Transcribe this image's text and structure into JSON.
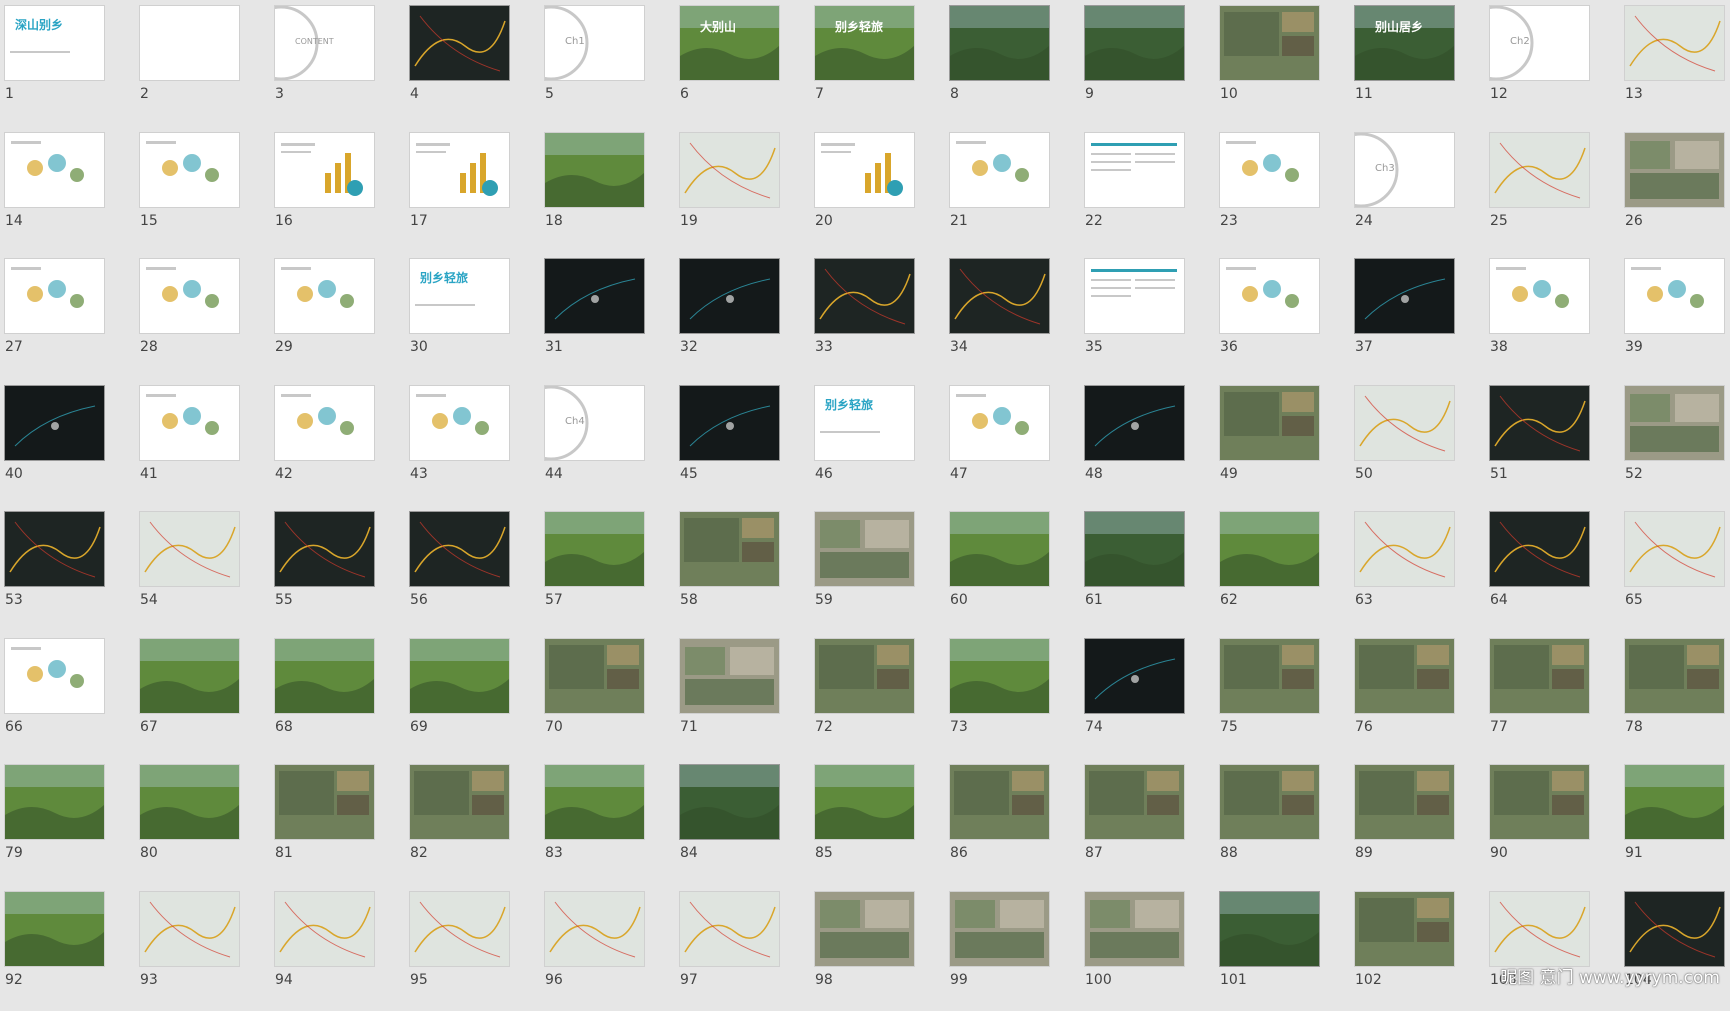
{
  "watermark": "昵图 意门 www.yyrym.com",
  "palette": {
    "white": "#ffffff",
    "dark": "#1e2523",
    "forest": "#3b5e34",
    "photo": "#6f7f5a",
    "greenField": "#5f8a3c",
    "sky": "#b9d3e6",
    "map": "#dfe4df",
    "night": "#14191a",
    "mixed": "#9b9a86",
    "accent": "#d9a62b",
    "red": "#d33a2c",
    "teal": "#2f9fb3",
    "gray": "#c8c8c8"
  },
  "slides": [
    {
      "num": "1",
      "kind": "title",
      "title": "深山别乡"
    },
    {
      "num": "2",
      "kind": "white"
    },
    {
      "num": "3",
      "kind": "chapter",
      "title": "CONTENT"
    },
    {
      "num": "4",
      "kind": "dark-map"
    },
    {
      "num": "5",
      "kind": "chapter",
      "title": "Ch1"
    },
    {
      "num": "6",
      "kind": "photo-green",
      "title": "大别山"
    },
    {
      "num": "7",
      "kind": "photo-green",
      "title": "别乡轻旅"
    },
    {
      "num": "8",
      "kind": "forest"
    },
    {
      "num": "9",
      "kind": "forest"
    },
    {
      "num": "10",
      "kind": "photo"
    },
    {
      "num": "11",
      "kind": "forest",
      "title": "别山居乡"
    },
    {
      "num": "12",
      "kind": "chapter",
      "title": "Ch2"
    },
    {
      "num": "13",
      "kind": "map"
    },
    {
      "num": "14",
      "kind": "diagram"
    },
    {
      "num": "15",
      "kind": "diagram"
    },
    {
      "num": "16",
      "kind": "chart"
    },
    {
      "num": "17",
      "kind": "chart"
    },
    {
      "num": "18",
      "kind": "photo-green"
    },
    {
      "num": "19",
      "kind": "map"
    },
    {
      "num": "20",
      "kind": "chart"
    },
    {
      "num": "21",
      "kind": "diagram"
    },
    {
      "num": "22",
      "kind": "text"
    },
    {
      "num": "23",
      "kind": "diagram"
    },
    {
      "num": "24",
      "kind": "chapter",
      "title": "Ch3"
    },
    {
      "num": "25",
      "kind": "map"
    },
    {
      "num": "26",
      "kind": "mixed"
    },
    {
      "num": "27",
      "kind": "diagram"
    },
    {
      "num": "28",
      "kind": "diagram"
    },
    {
      "num": "29",
      "kind": "diagram"
    },
    {
      "num": "30",
      "kind": "title",
      "title": "别乡轻旅"
    },
    {
      "num": "31",
      "kind": "dark"
    },
    {
      "num": "32",
      "kind": "dark"
    },
    {
      "num": "33",
      "kind": "dark-map"
    },
    {
      "num": "34",
      "kind": "dark-map"
    },
    {
      "num": "35",
      "kind": "text"
    },
    {
      "num": "36",
      "kind": "diagram"
    },
    {
      "num": "37",
      "kind": "dark"
    },
    {
      "num": "38",
      "kind": "diagram"
    },
    {
      "num": "39",
      "kind": "diagram"
    },
    {
      "num": "40",
      "kind": "dark"
    },
    {
      "num": "41",
      "kind": "diagram"
    },
    {
      "num": "42",
      "kind": "diagram"
    },
    {
      "num": "43",
      "kind": "diagram"
    },
    {
      "num": "44",
      "kind": "chapter",
      "title": "Ch4"
    },
    {
      "num": "45",
      "kind": "dark"
    },
    {
      "num": "46",
      "kind": "title",
      "title": "别乡轻旅"
    },
    {
      "num": "47",
      "kind": "diagram"
    },
    {
      "num": "48",
      "kind": "dark"
    },
    {
      "num": "49",
      "kind": "photo"
    },
    {
      "num": "50",
      "kind": "map"
    },
    {
      "num": "51",
      "kind": "dark-map"
    },
    {
      "num": "52",
      "kind": "mixed"
    },
    {
      "num": "53",
      "kind": "dark-map"
    },
    {
      "num": "54",
      "kind": "map"
    },
    {
      "num": "55",
      "kind": "dark-map"
    },
    {
      "num": "56",
      "kind": "dark-map"
    },
    {
      "num": "57",
      "kind": "photo-green"
    },
    {
      "num": "58",
      "kind": "photo"
    },
    {
      "num": "59",
      "kind": "mixed"
    },
    {
      "num": "60",
      "kind": "photo-green"
    },
    {
      "num": "61",
      "kind": "forest"
    },
    {
      "num": "62",
      "kind": "photo-green"
    },
    {
      "num": "63",
      "kind": "map"
    },
    {
      "num": "64",
      "kind": "dark-map"
    },
    {
      "num": "65",
      "kind": "map"
    },
    {
      "num": "66",
      "kind": "diagram"
    },
    {
      "num": "67",
      "kind": "photo-green"
    },
    {
      "num": "68",
      "kind": "photo-green"
    },
    {
      "num": "69",
      "kind": "photo-green"
    },
    {
      "num": "70",
      "kind": "photo"
    },
    {
      "num": "71",
      "kind": "mixed"
    },
    {
      "num": "72",
      "kind": "photo"
    },
    {
      "num": "73",
      "kind": "photo-green"
    },
    {
      "num": "74",
      "kind": "dark"
    },
    {
      "num": "75",
      "kind": "photo"
    },
    {
      "num": "76",
      "kind": "photo"
    },
    {
      "num": "77",
      "kind": "photo"
    },
    {
      "num": "78",
      "kind": "photo"
    },
    {
      "num": "79",
      "kind": "photo-green"
    },
    {
      "num": "80",
      "kind": "photo-green"
    },
    {
      "num": "81",
      "kind": "photo"
    },
    {
      "num": "82",
      "kind": "photo"
    },
    {
      "num": "83",
      "kind": "photo-green"
    },
    {
      "num": "84",
      "kind": "forest"
    },
    {
      "num": "85",
      "kind": "photo-green"
    },
    {
      "num": "86",
      "kind": "photo"
    },
    {
      "num": "87",
      "kind": "photo"
    },
    {
      "num": "88",
      "kind": "photo"
    },
    {
      "num": "89",
      "kind": "photo"
    },
    {
      "num": "90",
      "kind": "photo"
    },
    {
      "num": "91",
      "kind": "photo-green"
    },
    {
      "num": "92",
      "kind": "photo-green"
    },
    {
      "num": "93",
      "kind": "map"
    },
    {
      "num": "94",
      "kind": "map"
    },
    {
      "num": "95",
      "kind": "map"
    },
    {
      "num": "96",
      "kind": "map"
    },
    {
      "num": "97",
      "kind": "map"
    },
    {
      "num": "98",
      "kind": "mixed"
    },
    {
      "num": "99",
      "kind": "mixed"
    },
    {
      "num": "100",
      "kind": "mixed"
    },
    {
      "num": "101",
      "kind": "forest"
    },
    {
      "num": "102",
      "kind": "photo"
    },
    {
      "num": "103",
      "kind": "map"
    },
    {
      "num": "104",
      "kind": "dark-map"
    }
  ]
}
